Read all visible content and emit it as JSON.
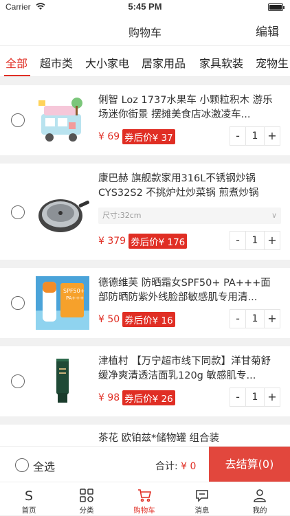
{
  "status": {
    "carrier": "Carrier",
    "time": "5:45 PM"
  },
  "header": {
    "title": "购物车",
    "edit_label": "编辑"
  },
  "tabs": [
    {
      "label": "全部",
      "active": true
    },
    {
      "label": "超市类"
    },
    {
      "label": "大小家电"
    },
    {
      "label": "居家用品"
    },
    {
      "label": "家具软装"
    },
    {
      "label": "宠物生"
    }
  ],
  "items": [
    {
      "name": "俐智 Loz 1737水果车 小颗粒积木 游乐场迷你街景 摆摊美食店冰激凌车...",
      "price": "¥ 69",
      "coupon": "券后价¥ 37",
      "qty": "1",
      "minus": "-",
      "plus": "+"
    },
    {
      "name": "康巴赫 旗舰款家用316L不锈钢炒锅CYS32S2 不挑炉灶炒菜锅 煎煮炒锅",
      "spec": "尺寸:32cm",
      "price": "¥ 379",
      "coupon": "券后价¥ 176",
      "qty": "1",
      "minus": "-",
      "plus": "+"
    },
    {
      "name": "德德维芙 防晒霜女SPF50+ PA+++面部防晒防紫外线脸部敏感肌专用清...",
      "price": "¥ 50",
      "coupon": "券后价¥ 16",
      "qty": "1",
      "minus": "-",
      "plus": "+"
    },
    {
      "name": "津植村 【万宁超市线下同款】洋甘菊舒缓净爽清透洁面乳120g 敏感肌专...",
      "price": "¥ 98",
      "coupon": "券后价¥ 26",
      "qty": "1",
      "minus": "-",
      "plus": "+"
    },
    {
      "name": "茶花 欧铂兹*储物罐 组合装"
    }
  ],
  "bottom": {
    "select_all": "全选",
    "total_label": "合计: ",
    "total_value": "¥ 0",
    "checkout": "去结算(0)"
  },
  "tabbar": [
    {
      "label": "首页",
      "icon": "home-s-icon"
    },
    {
      "label": "分类",
      "icon": "grid-icon"
    },
    {
      "label": "购物车",
      "icon": "cart-icon",
      "active": true
    },
    {
      "label": "消息",
      "icon": "message-icon"
    },
    {
      "label": "我的",
      "icon": "user-icon"
    }
  ],
  "colors": {
    "accent": "#e02e24",
    "checkout_bg": "#e2473d"
  }
}
